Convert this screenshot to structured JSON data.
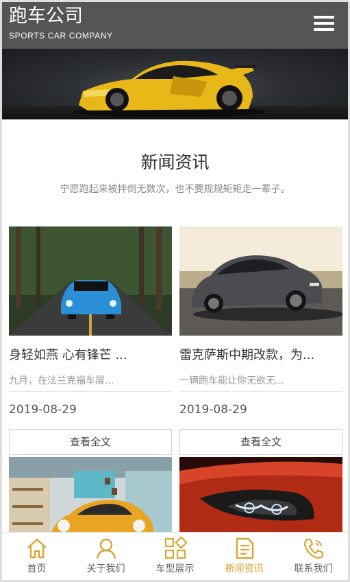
{
  "header": {
    "title": "跑车公司",
    "subtitle": "SPORTS CAR COMPANY",
    "menu_icon": "hamburger-menu-icon"
  },
  "banner": {
    "image": "yellow-sports-car-banner"
  },
  "section": {
    "title": "新闻资讯",
    "subtitle": "宁愿跑起来被拌倒无数次，也不要规规矩矩走一辈子。"
  },
  "news": [
    {
      "title": "身轻如燕 心有锋芒 ...",
      "desc": "九月，在法兰克福车展...",
      "date": "2019-08-29",
      "button": "查看全文",
      "image": "blue-bmw-forest-road"
    },
    {
      "title": "雷克萨斯中期改款，为...",
      "desc": "一辆跑车能让你无欲无...",
      "date": "2019-08-29",
      "button": "查看全文",
      "image": "gray-audi-sunset-road"
    },
    {
      "image": "orange-porsche-showroom"
    },
    {
      "image": "red-car-headlight-closeup"
    }
  ],
  "bottom_nav": {
    "accent_color": "#d9a534",
    "items": [
      {
        "label": "首页",
        "icon": "home-icon",
        "active": false
      },
      {
        "label": "关于我们",
        "icon": "user-icon",
        "active": false
      },
      {
        "label": "车型展示",
        "icon": "grid-icon",
        "active": false
      },
      {
        "label": "新闻资讯",
        "icon": "news-icon",
        "active": true
      },
      {
        "label": "联系我们",
        "icon": "phone-icon",
        "active": false
      }
    ]
  }
}
